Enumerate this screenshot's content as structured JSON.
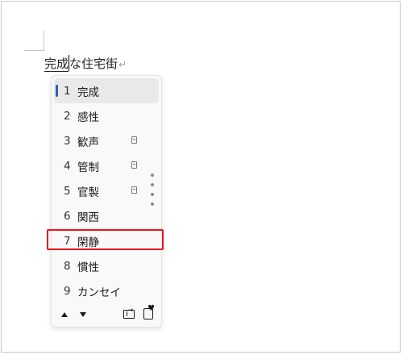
{
  "document": {
    "composing_text": "完成",
    "rest_text": "な住宅街",
    "paragraph_mark": "↵"
  },
  "ime": {
    "candidates": [
      {
        "number": "1",
        "text": "完成",
        "dictionary_icon": false,
        "selected": true
      },
      {
        "number": "2",
        "text": "感性",
        "dictionary_icon": false,
        "selected": false
      },
      {
        "number": "3",
        "text": "歓声",
        "dictionary_icon": true,
        "selected": false
      },
      {
        "number": "4",
        "text": "管制",
        "dictionary_icon": true,
        "selected": false
      },
      {
        "number": "5",
        "text": "官製",
        "dictionary_icon": true,
        "selected": false
      },
      {
        "number": "6",
        "text": "関西",
        "dictionary_icon": false,
        "selected": false
      },
      {
        "number": "7",
        "text": "閑静",
        "dictionary_icon": false,
        "selected": false
      },
      {
        "number": "8",
        "text": "慣性",
        "dictionary_icon": false,
        "selected": false
      },
      {
        "number": "9",
        "text": "カンセイ",
        "dictionary_icon": false,
        "selected": false
      }
    ],
    "highlighted_candidate": "7",
    "selection_color": "#2b5eb8",
    "highlight_color": "#e8141c",
    "footer": {
      "page_up_icon": "triangle-up-icon",
      "page_down_icon": "triangle-down-icon",
      "expand_icon": "expand-table-icon",
      "emoji_icon": "emoji-heart-icon"
    }
  }
}
